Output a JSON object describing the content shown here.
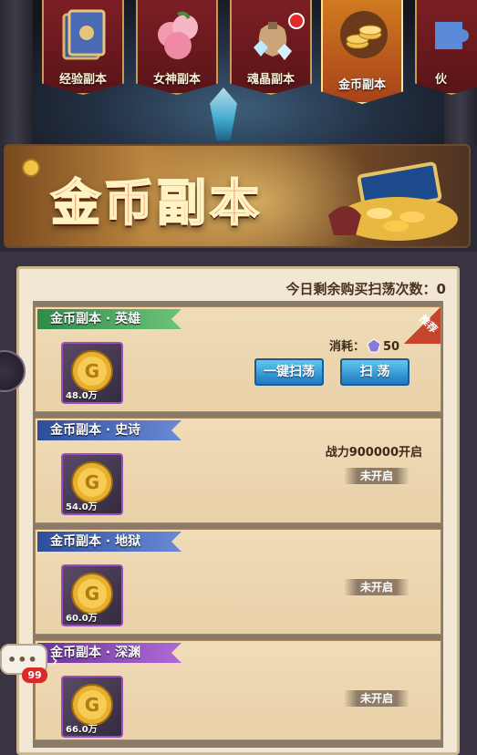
{
  "tabs": [
    {
      "label": "经验副本",
      "icon": "book-icon",
      "active": false
    },
    {
      "label": "女神副本",
      "icon": "peach-icon",
      "active": false
    },
    {
      "label": "魂晶副本",
      "icon": "crystal-bag-icon",
      "active": false,
      "badge": true
    },
    {
      "label": "金币副本",
      "icon": "gold-coins-icon",
      "active": true
    },
    {
      "label": "伙",
      "icon": "puzzle-icon",
      "active": false
    }
  ],
  "banner": {
    "title": "金币副本"
  },
  "remaining_sweeps": "今日剩余购买扫荡次数：0",
  "dungeons": [
    {
      "title": "金币副本 · 英雄",
      "amount": "48.0万",
      "cost_label": "消耗：",
      "cost_value": "50",
      "sweep_all": "一键扫荡",
      "sweep": "扫 荡",
      "tag": "推荐"
    },
    {
      "title": "金币副本 · 史诗",
      "amount": "54.0万",
      "condition": "战力900000开启",
      "status": "未开启"
    },
    {
      "title": "金币副本 · 地狱",
      "amount": "60.0万",
      "status": "未开启"
    },
    {
      "title": "金币副本 · 深渊",
      "amount": "66.0万",
      "status": "未开启"
    }
  ],
  "chat": {
    "dots": "•••",
    "count": "99"
  },
  "colors": {
    "accent_orange": "#d07a20",
    "tab_red": "#7c1f24",
    "button_blue": "#1f78c2"
  }
}
